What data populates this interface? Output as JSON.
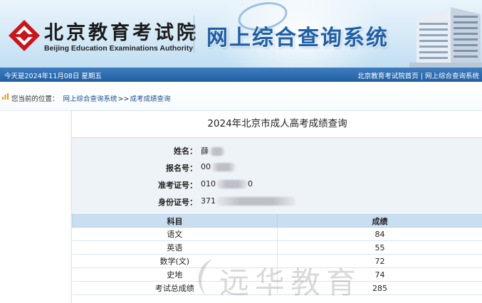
{
  "header": {
    "org_name_cn": "北京教育考试院",
    "org_name_en": "Beijing Education Examinations Authority",
    "site_title": "网上综合查询系统",
    "logo_icon": "bjeea-logo-icon",
    "building_icon": "building-illustration-icon"
  },
  "datebar": {
    "date_text": "今天是2024年11月08日  星期五",
    "links": [
      "北京教育考试院首页",
      "网上综合查询系统"
    ],
    "separator": "|"
  },
  "breadcrumb": {
    "label": "您当前的位置：",
    "items": [
      "网上综合查询系统",
      "成考成绩查询"
    ],
    "arrow": ">>"
  },
  "result": {
    "title": "2024年北京市成人高考成绩查询",
    "fields": [
      {
        "label": "姓名：",
        "value": "薛"
      },
      {
        "label": "报名号：",
        "value": "00"
      },
      {
        "label": "准考证号：",
        "value": "010",
        "suffix": "0"
      },
      {
        "label": "身份证号：",
        "value": "371"
      }
    ],
    "table": {
      "headers": [
        "科目",
        "成绩"
      ],
      "rows": [
        {
          "subject": "语文",
          "score": "84"
        },
        {
          "subject": "英语",
          "score": "55"
        },
        {
          "subject": "数学(文)",
          "score": "72"
        },
        {
          "subject": "史地",
          "score": "74"
        },
        {
          "subject": "考试总成绩",
          "score": "285"
        }
      ]
    }
  },
  "watermark": {
    "text": "远华教育"
  },
  "colors": {
    "nav_bar": "#205fa3",
    "title_blue": "#1f5fa6",
    "table_header": "#c9def0",
    "info_bg": "#eef3f8"
  }
}
